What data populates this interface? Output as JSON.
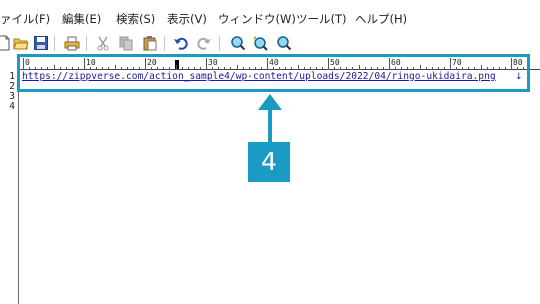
{
  "menu": {
    "items": [
      "ァイル(F)",
      "編集(E)",
      "検索(S)",
      "表示(V)",
      "ウィンドウ(W)",
      "ツール(T)",
      "ヘルプ(H)"
    ]
  },
  "toolbar": {
    "icons": [
      "new-file-icon",
      "open-folder-icon",
      "save-icon",
      "print-icon",
      "cut-icon",
      "copy-icon",
      "paste-icon",
      "undo-icon",
      "redo-icon",
      "find-icon",
      "find-next-icon",
      "find-previous-icon"
    ]
  },
  "ruler": {
    "labels": [
      "0",
      "10",
      "20",
      "30",
      "40",
      "50",
      "60",
      "70",
      "80"
    ]
  },
  "editor": {
    "line_numbers": [
      "1",
      "2",
      "3",
      "4"
    ],
    "line1": "https://zippverse.com/action_sample4/wp-content/uploads/2022/04/ringo-ukidaira.png",
    "eol_mark": "↓"
  },
  "annotation": {
    "badge": "4",
    "color": "#1a9bc4"
  }
}
